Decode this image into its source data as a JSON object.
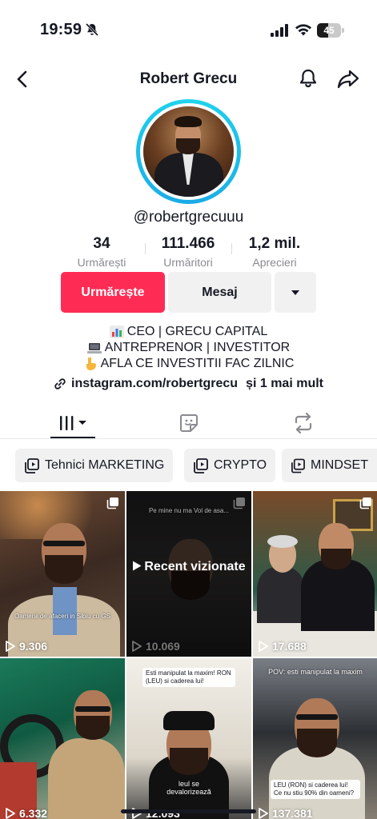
{
  "status_bar": {
    "time": "19:59",
    "battery": "45",
    "battery_level": 0.45,
    "icons": [
      "bell-mute-icon",
      "signal-icon",
      "wifi-icon",
      "battery-icon"
    ]
  },
  "header": {
    "title": "Robert Grecu",
    "icons": [
      "back-icon",
      "bell-icon",
      "share-icon"
    ]
  },
  "profile": {
    "username": "@robertgrecuuu",
    "stats": [
      {
        "value": "34",
        "label": "Urmărești"
      },
      {
        "value": "111.466",
        "label": "Urmăritori"
      },
      {
        "value": "1,2 mil.",
        "label": "Aprecieri"
      }
    ],
    "buttons": {
      "follow": "Urmărește",
      "message": "Mesaj"
    },
    "bio": [
      {
        "icon": "chart-emoji",
        "text": "CEO | GRECU CAPITAL"
      },
      {
        "icon": "laptop-emoji",
        "text": "ANTREPRENOR | INVESTITOR"
      },
      {
        "icon": "pointing-down-emoji",
        "text": "AFLA CE INVESTITII FAC ZILNIC"
      }
    ],
    "link": {
      "text": "instagram.com/robertgrecu",
      "more": "și 1 mai mult"
    }
  },
  "tabs": [
    {
      "icon": "grid-icon",
      "active": true
    },
    {
      "icon": "sticker-icon",
      "active": false
    },
    {
      "icon": "repost-icon",
      "active": false
    }
  ],
  "playlists": [
    {
      "label": "Tehnici MARKETING"
    },
    {
      "label": "CRYPTO"
    },
    {
      "label": "MINDSET"
    }
  ],
  "videos": [
    {
      "views": "9.306",
      "caption": "Oamenii de afaceri in Sibiu cu GS",
      "multi": true
    },
    {
      "views": "10.069",
      "caption": "Pe mine nu ma Vol de asa...",
      "recent_label": "Recent vizionate",
      "multi": true
    },
    {
      "views": "17.688",
      "caption": "",
      "multi": true
    },
    {
      "views": "6.332",
      "caption": "",
      "multi": false
    },
    {
      "views": "12.093",
      "tag": "Esti manipulat la maxim! RON (LEU) si caderea lui!",
      "caption": "leul se devalorizează",
      "multi": false
    },
    {
      "views": "137.381",
      "caption": "POV: esti manipulat la maxim",
      "tag": "LEU (RON) si caderea lui! Ce nu stiu 90% din oameni?",
      "multi": false
    }
  ],
  "colors": {
    "accent": "#fe2c55",
    "ring": "#20d5ec",
    "secondary_bg": "#f1f1f2",
    "muted_text": "#8a8b91"
  }
}
